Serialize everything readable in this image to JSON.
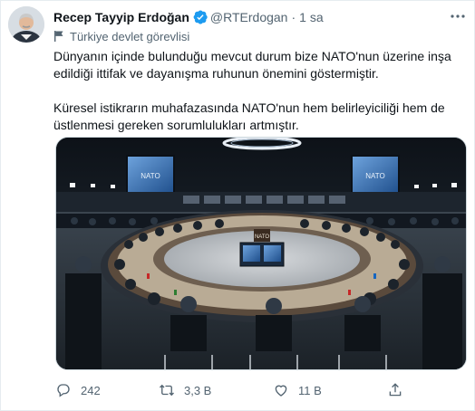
{
  "tweet": {
    "author_name": "Recep Tayyip Erdoğan",
    "handle": "@RTErdogan",
    "separator": "·",
    "time": "1 sa",
    "account_label": "Türkiye devlet görevlisi",
    "paragraphs": [
      "Dünyanın içinde bulunduğu mevcut durum bize NATO'nun üzerine inşa edildiği ittifak ve dayanışma ruhunun önemini göstermiştir.",
      "Küresel istikrarın muhafazasında NATO'nun hem belirleyiciliği hem de üstlenmesi gereken sorumlulukları artmıştır."
    ],
    "media": {
      "screen_text": "NATO",
      "desk_sign": "NATO"
    },
    "actions": {
      "replies": "242",
      "retweets": "3,3 B",
      "likes": "11 B",
      "share": ""
    }
  },
  "icons": [
    "verified-badge-icon",
    "more-icon",
    "government-flag-icon",
    "reply-icon",
    "retweet-icon",
    "like-icon",
    "share-icon"
  ],
  "colors": {
    "verified": "#1d9bf0",
    "secondary_text": "#536471"
  }
}
